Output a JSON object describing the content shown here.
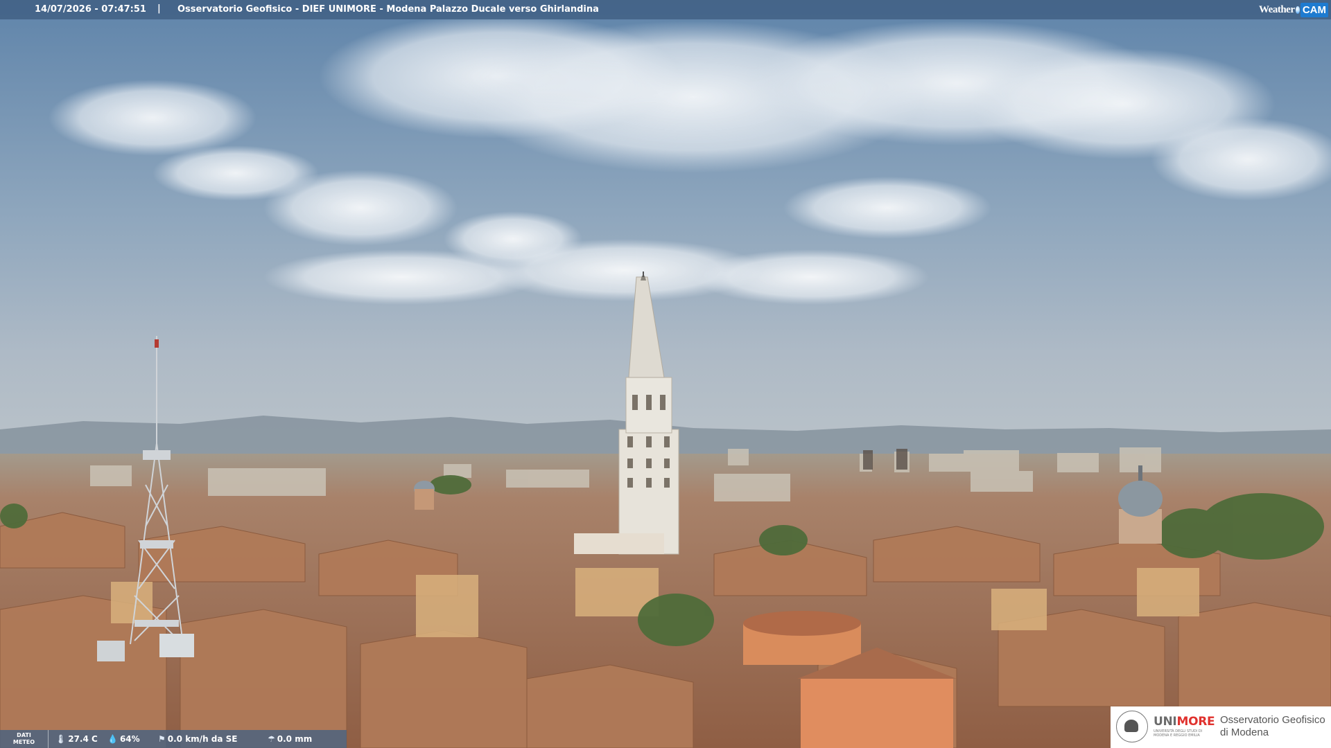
{
  "overlay": {
    "timestamp": "14/07/2026 - 07:47:51",
    "separator": "|",
    "title": "Osservatorio Geofisico - DIEF UNIMORE - Modena Palazzo Ducale verso Ghirlandina",
    "brand_weather": "Weather",
    "brand_cam": "CAM"
  },
  "meteo": {
    "label_line1": "DATI",
    "label_line2": "METEO",
    "temperature": "27.4 C",
    "humidity": "64%",
    "wind": "0.0 km/h da SE",
    "rain": "0.0 mm",
    "icons": [
      "thermometer-icon",
      "humidity-drop-icon",
      "wind-icon",
      "rain-icon"
    ]
  },
  "logo": {
    "brand_uni": "UNI",
    "brand_more": "MORE",
    "sub": "UNIVERSITÀ DEGLI STUDI DI MODENA E REGGIO EMILIA",
    "obs_line1": "Osservatorio Geofisico",
    "obs_line2": "di Modena"
  },
  "colors": {
    "sky_top": "#6f90b2",
    "sky_horizon": "#b7c3cd",
    "roof": "#a8724f",
    "tower": "#e8e4dc",
    "accent_more": "#e0322e"
  }
}
